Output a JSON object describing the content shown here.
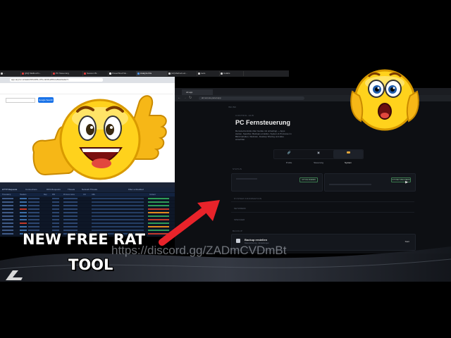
{
  "browser": {
    "tabs": [
      {
        "label": "...",
        "color": "#cccccc"
      },
      {
        "label": "[[AI]] Mailbox/In...",
        "color": "#e23b3b"
      },
      {
        "label": "PC Steuerung",
        "color": "#e23b3b"
      },
      {
        "label": "Session Br...",
        "color": "#e23b3b"
      },
      {
        "label": "PowerShell Mo...",
        "color": "#ffffff"
      },
      {
        "label": "Analyze this",
        "color": "#4a90e2"
      },
      {
        "label": "[AI] Method ext...",
        "color": "#cccccc"
      },
      {
        "label": "tools",
        "color": "#cccccc"
      },
      {
        "label": "Colabs",
        "color": "#cccccc"
      }
    ],
    "left_url": "app.anyrun.io/tasks/f15c48f1-c07e-4d49-af86-ba52a01a0e7c",
    "right_tab": "Alt app",
    "right_url": "alt.remote-panel.app"
  },
  "left_page": {
    "search_button": "Google Search"
  },
  "task_manager": {
    "tabs": [
      "HTTP Requests",
      "Connections",
      "DNS Requests",
      "Threats",
      "Network Threats"
    ],
    "toolbar_right": "Filter embedded",
    "columns": [
      "Timestamp",
      "Headers",
      "Rep",
      "PID",
      "Process name",
      "CN",
      "URL",
      "Content"
    ]
  },
  "app": {
    "brand": "INC.INC",
    "kicker": "CONTROL HUB",
    "title": "PC Fernsteuerung",
    "description": "Remote-Kontrolle über Geräte mit unbedingt — Apps starten, Speicher, Backups erstellen, System & Prozesse im Blick behalten, Webcam, Desktop Sharing und alles einsehbar.",
    "nav": [
      {
        "label": "Profile"
      },
      {
        "label": "Steuerung"
      },
      {
        "label": "System"
      }
    ],
    "section_status": "STATUS",
    "status_left_button": "AKTUALISIEREN",
    "status_right_button": "SYSTEM SPEICHERN",
    "section_sysinfo": "SYSTEM INFORMATION",
    "row_netzwerk": "NETZWERK",
    "row_speicher": "SPEICHER",
    "section_backup": "BACKUP",
    "backup_title": "Backup erstellen",
    "backup_sub": "Datensicherung · Einstellungen",
    "backup_action": "Start"
  },
  "overlay": {
    "watermark": "https://discord.gg/ZADmCVDmBt",
    "headline_line1": "NEW FREE RAT",
    "headline_line2": "TOOL"
  },
  "colors": {
    "arrow": "#e8232a",
    "emoji_face": "#ffd21c",
    "badge_green": "#2e9b57",
    "badge_red": "#c0392b",
    "badge_orange": "#e08a1e"
  }
}
